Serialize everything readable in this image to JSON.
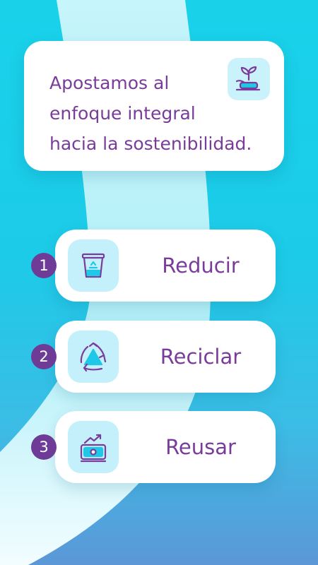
{
  "intro": {
    "lines": [
      "Apostamos al",
      "enfoque integral",
      "hacia la sostenibilidad."
    ],
    "icon": "plant-hand-icon"
  },
  "items": [
    {
      "number": "1",
      "label": "Reducir",
      "icon": "trash-bin-icon"
    },
    {
      "number": "2",
      "label": "Reciclar",
      "icon": "recycle-icon"
    },
    {
      "number": "3",
      "label": "Reusar",
      "icon": "money-growth-icon"
    }
  ],
  "colors": {
    "background": "#19d2ea",
    "accent": "#7a3c9a",
    "number_badge": "#6e3c96",
    "icon_box": "#c4f0fb",
    "icon_fill": "#1ec8e6"
  }
}
